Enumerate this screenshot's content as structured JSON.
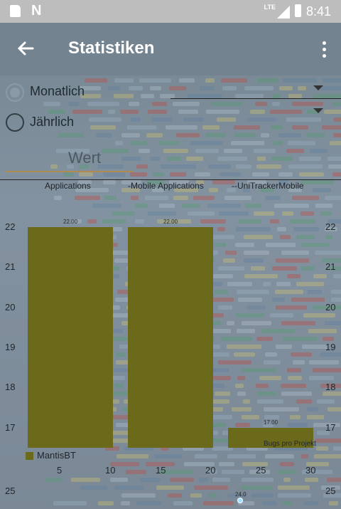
{
  "status_bar": {
    "time": "8:41",
    "network": "LTE"
  },
  "app_bar": {
    "title": "Statistiken"
  },
  "filters": {
    "monthly_label": "Monatlich",
    "yearly_label": "Jährlich",
    "monthly_selected": true,
    "value_placeholder": "Wert"
  },
  "chart_data": {
    "type": "bar",
    "categories": [
      "Applications",
      "-Mobile Applications",
      "--UniTrackerMobile"
    ],
    "series": [
      {
        "name": "MantisBT",
        "values": [
          22.0,
          22.0,
          17.0
        ],
        "color": "#6b6a1a"
      }
    ],
    "value_labels": [
      "22.00",
      "22.00",
      "17.00"
    ],
    "description": "Bugs pro Projekt",
    "ylim": [
      16.5,
      22.3
    ],
    "yticks": [
      "22",
      "21",
      "20",
      "19",
      "18",
      "17"
    ],
    "xticks": [
      "5",
      "10",
      "15",
      "20",
      "25",
      "30"
    ],
    "second_chart": {
      "ytick": "25",
      "point_label": "24.0",
      "point_color": "#9ee0ff"
    }
  }
}
